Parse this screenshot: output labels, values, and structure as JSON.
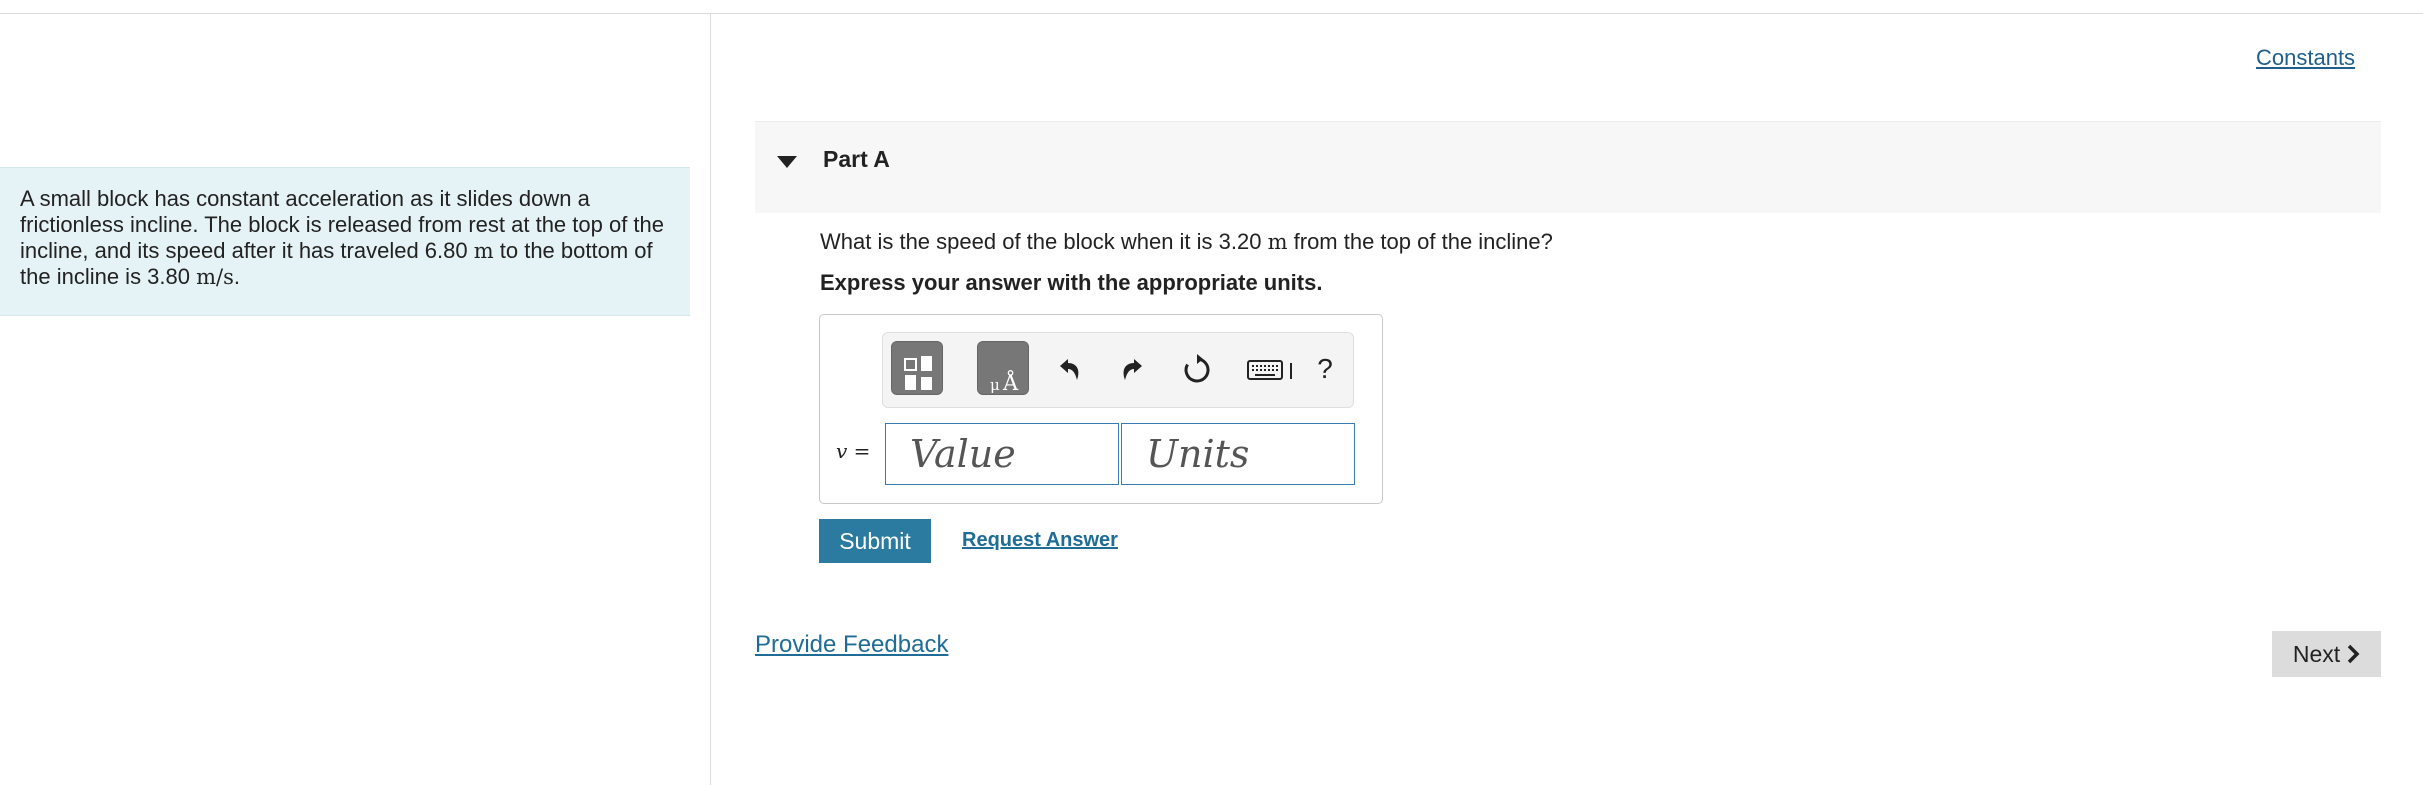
{
  "problem": {
    "text_before_distance": "A small block has constant acceleration as it slides down a frictionless incline. The block is released from rest at the top of the incline, and its speed after it has traveled 6.80 ",
    "distance_unit": "m",
    "text_before_speed": " to the bottom of the incline is 3.80 ",
    "speed_unit": "m/s",
    "text_end": "."
  },
  "header": {
    "constants_label": "Constants"
  },
  "part": {
    "title": "Part A"
  },
  "question": {
    "text_before": "What is the speed of the block when it is 3.20 ",
    "unit": "m",
    "text_after": " from the top of the incline?",
    "instruction": "Express your answer with the appropriate units."
  },
  "answer": {
    "variable": "v",
    "equals": " =",
    "value_placeholder": "Value",
    "units_placeholder": "Units",
    "help_label": "?"
  },
  "actions": {
    "submit_label": "Submit",
    "request_answer_label": "Request Answer",
    "feedback_label": "Provide Feedback",
    "next_label": "Next"
  },
  "icons": {
    "templates": "templates-icon",
    "units_symbols": "units-symbols-icon",
    "undo": "undo-icon",
    "redo": "redo-icon",
    "reset": "reset-icon",
    "keyboard": "keyboard-icon",
    "next": "chevron-right-icon"
  },
  "colors": {
    "accent": "#2b7aa0",
    "link": "#1f6c96",
    "problem_bg": "#e6f3f6",
    "input_border": "#3a7ab2"
  }
}
